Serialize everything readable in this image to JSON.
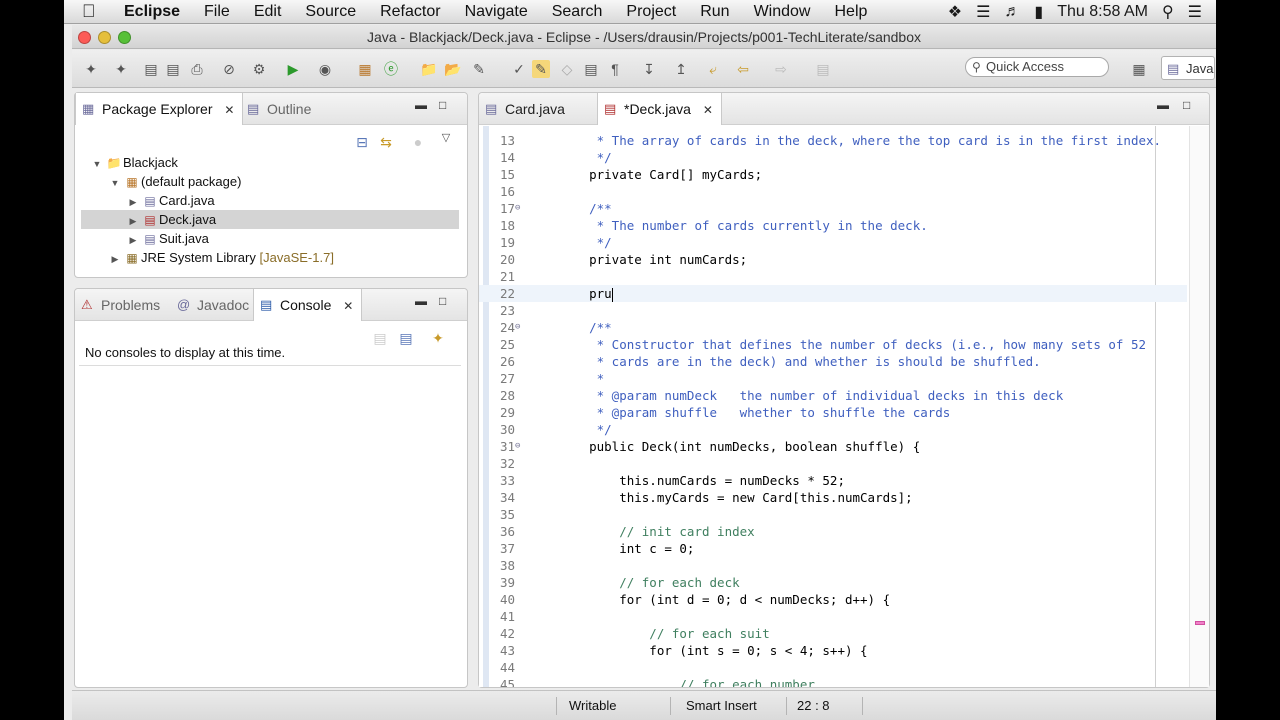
{
  "menubar": {
    "app": "Eclipse",
    "items": [
      "File",
      "Edit",
      "Source",
      "Refactor",
      "Navigate",
      "Search",
      "Project",
      "Run",
      "Window",
      "Help"
    ],
    "clock": "Thu 8:58 AM"
  },
  "window": {
    "title": "Java - Blackjack/Deck.java - Eclipse - /Users/drausin/Projects/p001-TechLiterate/sandbox"
  },
  "toolbar": {
    "quick_access": "Quick Access",
    "perspective": "Java"
  },
  "package_explorer": {
    "tab_label": "Package Explorer",
    "outline_label": "Outline",
    "tree": [
      {
        "label": "Blackjack",
        "expanded": true
      },
      {
        "label": "(default package)",
        "expanded": true
      },
      {
        "label": "Card.java",
        "expanded": false
      },
      {
        "label": "Deck.java",
        "expanded": false,
        "selected": true
      },
      {
        "label": "Suit.java",
        "expanded": false
      },
      {
        "label": "JRE System Library",
        "suffix": "[JavaSE-1.7]",
        "expanded": false
      }
    ]
  },
  "bottom_panel": {
    "tabs": [
      "Problems",
      "Javadoc",
      "Console"
    ],
    "active": "Console",
    "message": "No consoles to display at this time."
  },
  "editor": {
    "tabs": [
      "Card.java",
      "*Deck.java"
    ],
    "active": "*Deck.java",
    "lines": [
      {
        "n": "13",
        "text": "     * The array of cards in the deck, where the top card is in the first index."
      },
      {
        "n": "14",
        "text": "     */"
      },
      {
        "n": "15",
        "text": "    private Card[] myCards;"
      },
      {
        "n": "16",
        "text": ""
      },
      {
        "n": "17",
        "text": "    /**"
      },
      {
        "n": "18",
        "text": "     * The number of cards currently in the deck."
      },
      {
        "n": "19",
        "text": "     */"
      },
      {
        "n": "20",
        "text": "    private int numCards;"
      },
      {
        "n": "21",
        "text": ""
      },
      {
        "n": "22",
        "text": "    pru"
      },
      {
        "n": "23",
        "text": ""
      },
      {
        "n": "24",
        "text": "    /**"
      },
      {
        "n": "25",
        "text": "     * Constructor that defines the number of decks (i.e., how many sets of 52"
      },
      {
        "n": "26",
        "text": "     * cards are in the deck) and whether is should be shuffled."
      },
      {
        "n": "27",
        "text": "     *"
      },
      {
        "n": "28",
        "text": "     * @param numDeck   the number of individual decks in this deck"
      },
      {
        "n": "29",
        "text": "     * @param shuffle   whether to shuffle the cards"
      },
      {
        "n": "30",
        "text": "     */"
      },
      {
        "n": "31",
        "text": "    public Deck(int numDecks, boolean shuffle) {"
      },
      {
        "n": "32",
        "text": ""
      },
      {
        "n": "33",
        "text": "        this.numCards = numDecks * 52;"
      },
      {
        "n": "34",
        "text": "        this.myCards = new Card[this.numCards];"
      },
      {
        "n": "35",
        "text": ""
      },
      {
        "n": "36",
        "text": "        // init card index"
      },
      {
        "n": "37",
        "text": "        int c = 0;"
      },
      {
        "n": "38",
        "text": ""
      },
      {
        "n": "39",
        "text": "        // for each deck"
      },
      {
        "n": "40",
        "text": "        for (int d = 0; d < numDecks; d++) {"
      },
      {
        "n": "41",
        "text": ""
      },
      {
        "n": "42",
        "text": "            // for each suit"
      },
      {
        "n": "43",
        "text": "            for (int s = 0; s < 4; s++) {"
      },
      {
        "n": "44",
        "text": ""
      },
      {
        "n": "45",
        "text": "                // for each number"
      }
    ]
  },
  "status": {
    "writable": "Writable",
    "insert_mode": "Smart Insert",
    "position": "22 : 8"
  }
}
